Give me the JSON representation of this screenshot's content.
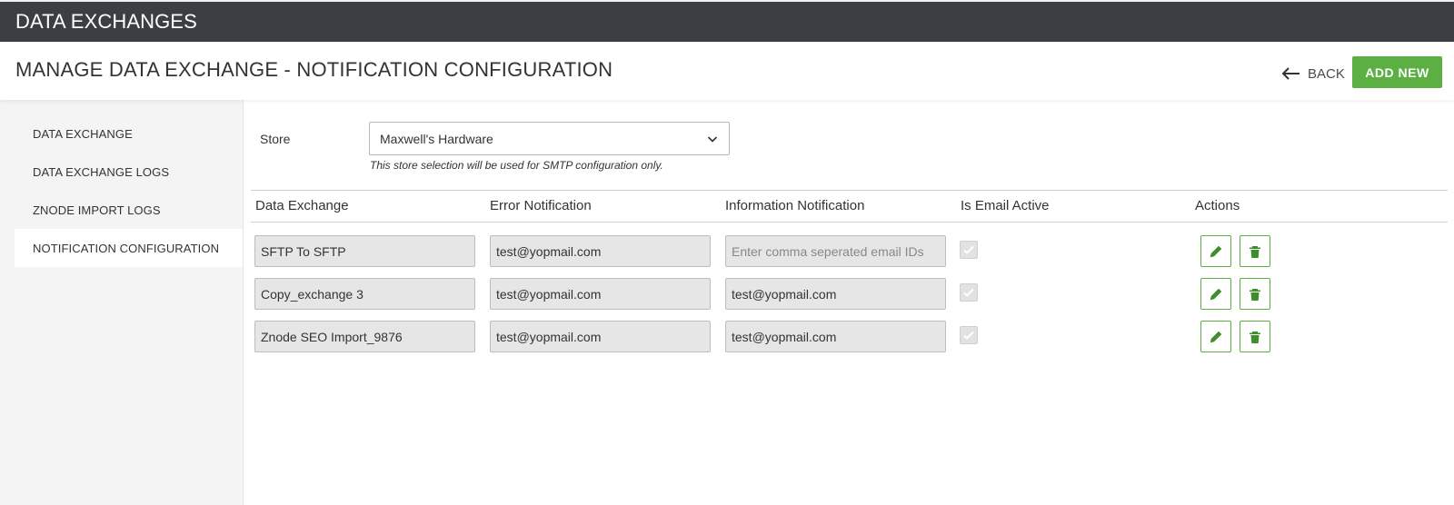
{
  "app": {
    "title": "DATA EXCHANGES"
  },
  "header": {
    "title": "MANAGE DATA EXCHANGE - NOTIFICATION CONFIGURATION",
    "back_label": "BACK",
    "add_new_label": "ADD NEW"
  },
  "sidebar": {
    "items": [
      {
        "label": "DATA EXCHANGE"
      },
      {
        "label": "DATA EXCHANGE LOGS"
      },
      {
        "label": "ZNODE IMPORT LOGS"
      },
      {
        "label": "NOTIFICATION CONFIGURATION",
        "active": true
      }
    ]
  },
  "store": {
    "label": "Store",
    "selected": "Maxwell's Hardware",
    "hint": "This store selection will be used for SMTP configuration only."
  },
  "grid": {
    "columns": [
      "Data Exchange",
      "Error Notification",
      "Information Notification",
      "Is Email Active",
      "Actions"
    ],
    "info_placeholder": "Enter comma seperated email IDs",
    "rows": [
      {
        "exchange": "SFTP To SFTP",
        "error": "test@yopmail.com",
        "info": "",
        "email_active": true
      },
      {
        "exchange": "Copy_exchange 3",
        "error": "test@yopmail.com",
        "info": "test@yopmail.com",
        "email_active": true
      },
      {
        "exchange": "Znode SEO Import_9876",
        "error": "test@yopmail.com",
        "info": "test@yopmail.com",
        "email_active": true
      }
    ]
  },
  "colors": {
    "topbar": "#3b3e43",
    "accent_green": "#5cb043",
    "sidebar_bg": "#f4f4f4",
    "input_bg": "#e6e6e6"
  },
  "icons": {
    "back": "arrow-left-icon",
    "dropdown": "chevron-down-icon",
    "edit": "pencil-icon",
    "delete": "trash-icon",
    "check": "check-icon"
  }
}
